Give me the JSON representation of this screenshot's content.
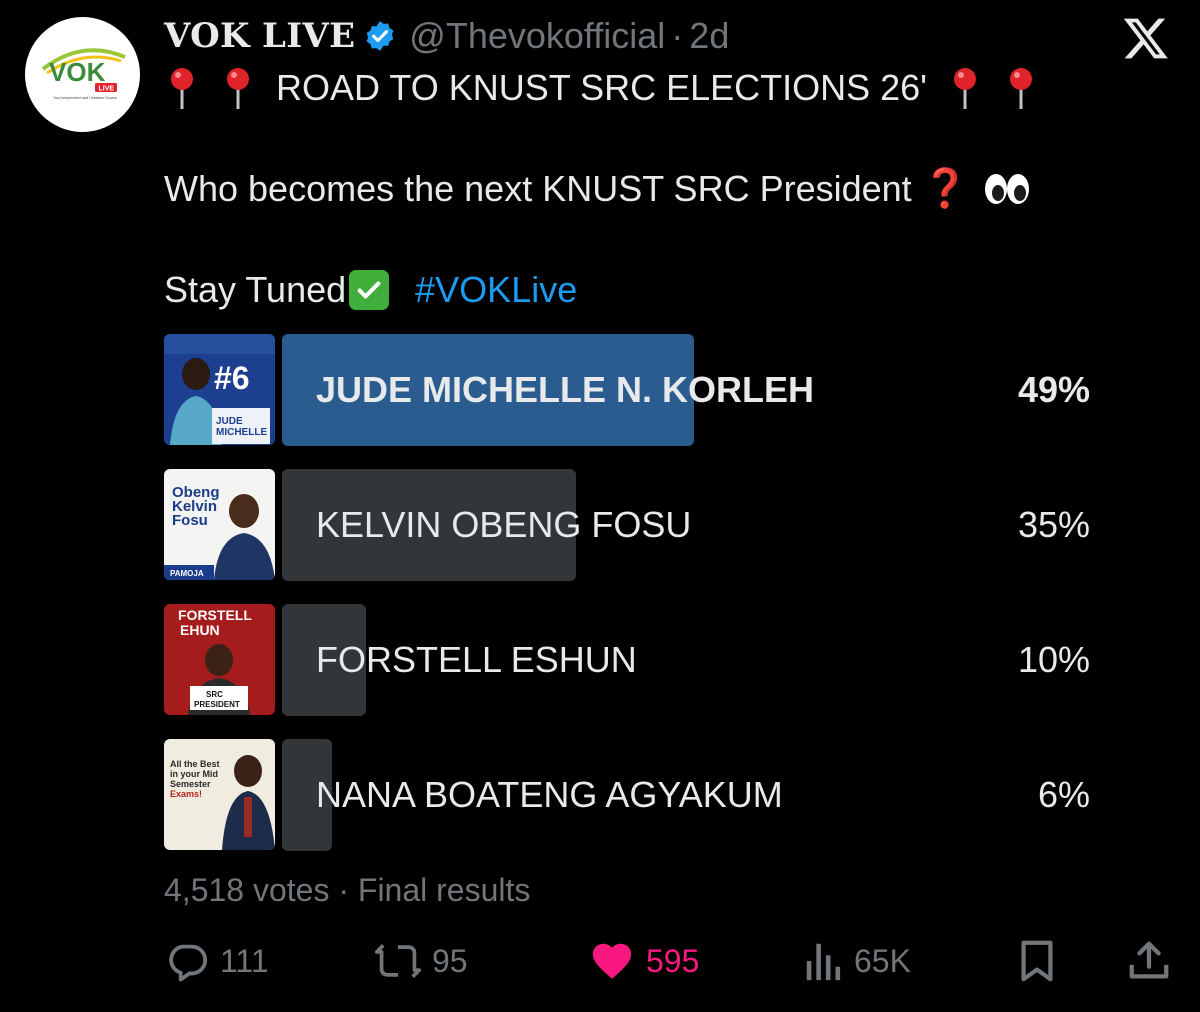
{
  "author": {
    "display_name": "VOK LIVE",
    "handle": "@Thevokofficial",
    "separator": "·",
    "time": "2d",
    "verified": true,
    "avatar_logo_text": "VOK",
    "avatar_badge_text": "LIVE",
    "avatar_tagline": "Your Independent and Unbiased Source"
  },
  "tweet": {
    "line1": "ROAD TO KNUST SRC ELECTIONS 26'",
    "line2": "Who becomes the next KNUST SRC President",
    "line2_symbol": "❓",
    "line3": "Stay Tuned",
    "hashtag": "#VOKLive"
  },
  "poll": {
    "options": [
      {
        "label": "JUDE MICHELLE N. KORLEH",
        "percent": 49,
        "percent_label": "49%",
        "winner": true,
        "thumb_text": [
          "#6",
          "JUDE",
          "MICHELLE"
        ]
      },
      {
        "label": "KELVIN OBENG FOSU",
        "percent": 35,
        "percent_label": "35%",
        "winner": false,
        "thumb_text": [
          "Obeng",
          "Kelvin",
          "Fosu",
          "PAMOJA"
        ]
      },
      {
        "label": "FORSTELL ESHUN",
        "percent": 10,
        "percent_label": "10%",
        "winner": false,
        "thumb_text": [
          "FORSTELL",
          "EHUN",
          "SRC",
          "PRESIDENT"
        ]
      },
      {
        "label": "NANA BOATENG AGYAKUM",
        "percent": 6,
        "percent_label": "6%",
        "winner": false,
        "thumb_text": [
          "All the Best",
          "in your Mid",
          "Semester",
          "Exams!"
        ]
      }
    ],
    "votes": "4,518 votes",
    "meta_separator": "·",
    "status": "Final results"
  },
  "actions": {
    "replies": "111",
    "reposts": "95",
    "likes": "595",
    "views": "65K"
  },
  "colors": {
    "background": "#000000",
    "text": "#e7e9ea",
    "muted": "#71767b",
    "accent": "#1d9bf0",
    "winner_bar": "#2b5c8f",
    "bar": "#333639",
    "like": "#f91880"
  }
}
